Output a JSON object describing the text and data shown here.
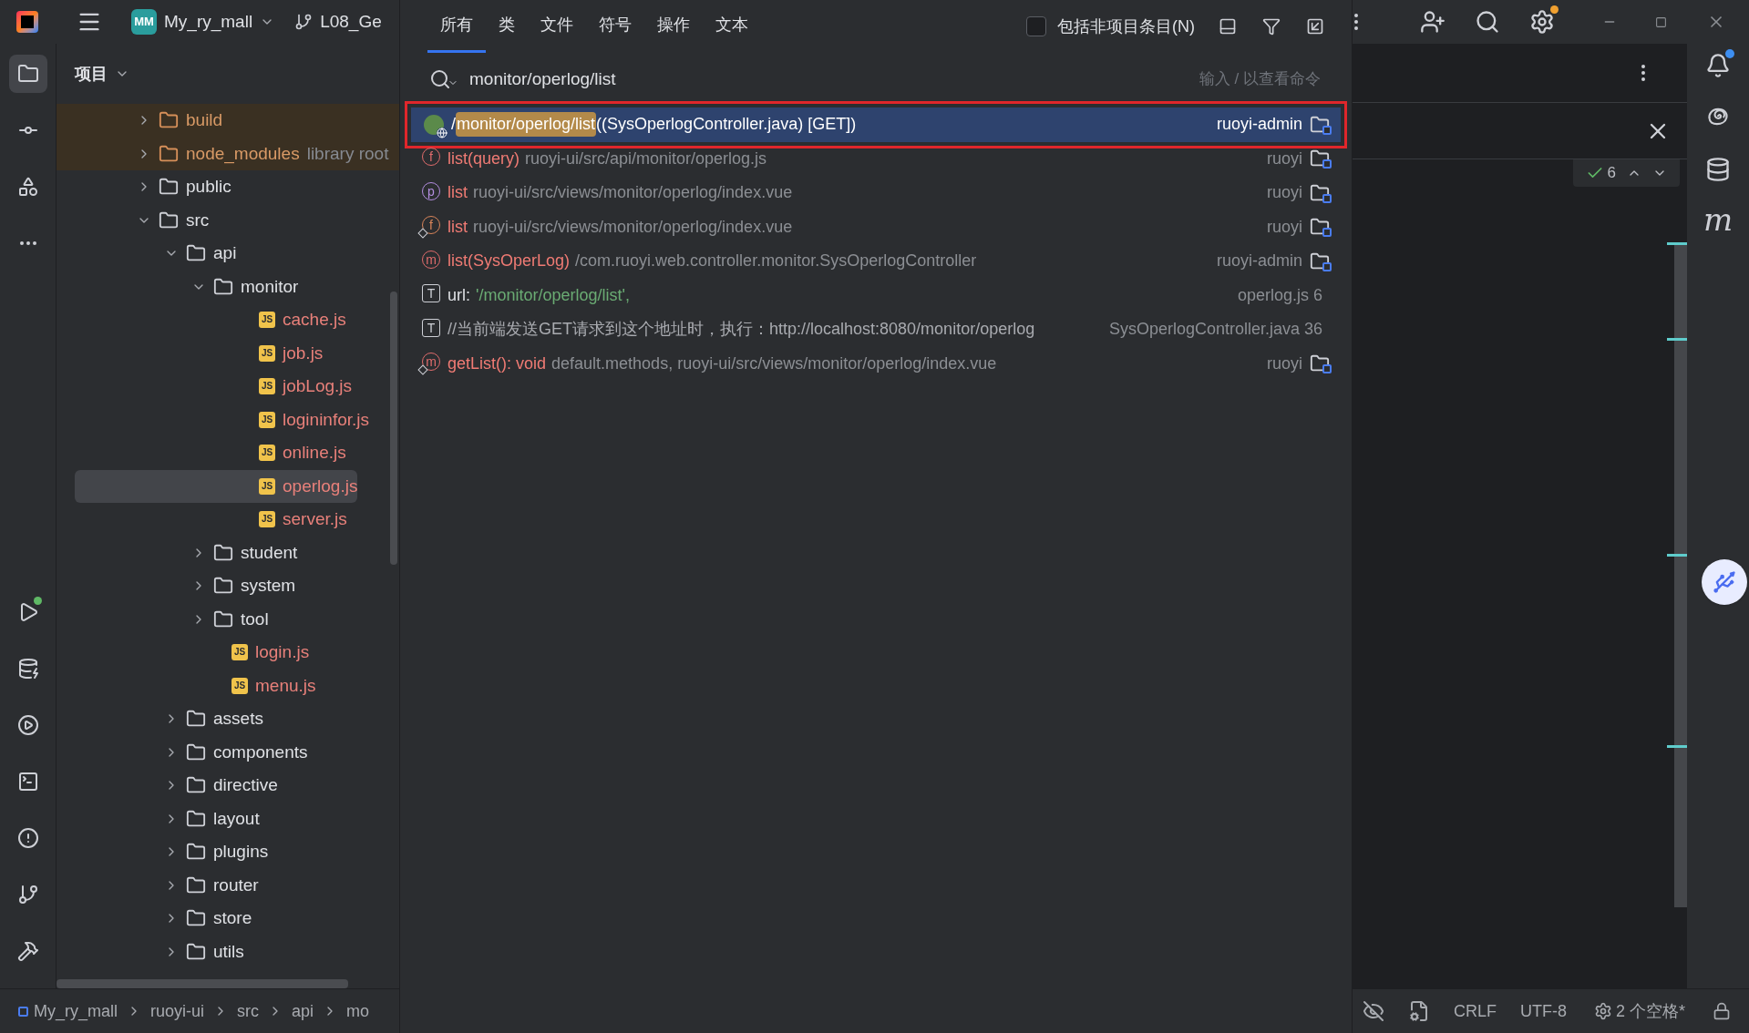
{
  "top_bar": {
    "project_badge": "MM",
    "project": "My_ry_mall",
    "branch": "L08_Ge"
  },
  "project_panel": {
    "title": "项目",
    "tree": [
      {
        "name": "build",
        "kind": "excluded",
        "expanded": false,
        "selected": false
      },
      {
        "name": "node_modules",
        "kind": "excluded",
        "hint": "library root",
        "expanded": false,
        "selected": false
      },
      {
        "name": "public",
        "kind": "folder",
        "expanded": false,
        "selected": false
      },
      {
        "name": "src",
        "kind": "folder",
        "expanded": true,
        "selected": false,
        "children": [
          {
            "name": "api",
            "kind": "folder",
            "expanded": true,
            "selected": false,
            "children": [
              {
                "name": "monitor",
                "kind": "folder",
                "expanded": true,
                "selected": false,
                "children": [
                  {
                    "name": "cache.js",
                    "kind": "js",
                    "badge": "JS",
                    "selected": false
                  },
                  {
                    "name": "job.js",
                    "kind": "js",
                    "badge": "JS",
                    "selected": false
                  },
                  {
                    "name": "jobLog.js",
                    "kind": "js",
                    "badge": "JS",
                    "selected": false
                  },
                  {
                    "name": "logininfor.js",
                    "kind": "js",
                    "badge": "JS",
                    "selected": false
                  },
                  {
                    "name": "online.js",
                    "kind": "js",
                    "badge": "JS",
                    "selected": false
                  },
                  {
                    "name": "operlog.js",
                    "kind": "js",
                    "badge": "JS",
                    "selected": true
                  },
                  {
                    "name": "server.js",
                    "kind": "js",
                    "badge": "JS",
                    "selected": false
                  }
                ]
              },
              {
                "name": "student",
                "kind": "folder",
                "expanded": false,
                "selected": false
              },
              {
                "name": "system",
                "kind": "folder",
                "expanded": false,
                "selected": false
              },
              {
                "name": "tool",
                "kind": "folder",
                "expanded": false,
                "selected": false
              },
              {
                "name": "login.js",
                "kind": "js",
                "badge": "JS",
                "selected": false
              },
              {
                "name": "menu.js",
                "kind": "js",
                "badge": "JS",
                "selected": false
              }
            ]
          },
          {
            "name": "assets",
            "kind": "folder",
            "expanded": false,
            "selected": false
          },
          {
            "name": "components",
            "kind": "folder",
            "expanded": false,
            "selected": false
          },
          {
            "name": "directive",
            "kind": "folder",
            "expanded": false,
            "selected": false
          },
          {
            "name": "layout",
            "kind": "folder",
            "expanded": false,
            "selected": false
          },
          {
            "name": "plugins",
            "kind": "folder",
            "expanded": false,
            "selected": false
          },
          {
            "name": "router",
            "kind": "folder",
            "expanded": false,
            "selected": false
          },
          {
            "name": "store",
            "kind": "folder",
            "expanded": false,
            "selected": false
          },
          {
            "name": "utils",
            "kind": "folder",
            "expanded": false,
            "selected": false
          }
        ]
      }
    ]
  },
  "search_popup": {
    "tabs": [
      {
        "label": "所有",
        "selected": true
      },
      {
        "label": "类",
        "selected": false
      },
      {
        "label": "文件",
        "selected": false
      },
      {
        "label": "符号",
        "selected": false
      },
      {
        "label": "操作",
        "selected": false
      },
      {
        "label": "文本",
        "selected": false
      }
    ],
    "include_non_project": {
      "label": "包括非项目条目(N)",
      "checked": false
    },
    "search": {
      "value": "monitor/operlog/list",
      "placeholder": "输入 / 以查看命令"
    },
    "results": [
      {
        "kind": "endpoint",
        "prefix": "/",
        "match": "monitor/operlog/list",
        "name": " ((SysOperlogController.java) [GET])",
        "location": "ruoyi-admin",
        "folder": true,
        "selected": true
      },
      {
        "kind": "symbol",
        "letter": "f",
        "color": "#e06c6c",
        "name": "list(query)",
        "detail": "ruoyi-ui/src/api/monitor/operlog.js",
        "location": "ruoyi",
        "folder": true,
        "overlay": false,
        "selected": false
      },
      {
        "kind": "symbol",
        "letter": "p",
        "color": "#b48ee0",
        "name": "list",
        "detail": "ruoyi-ui/src/views/monitor/operlog/index.vue",
        "location": "ruoyi",
        "folder": true,
        "overlay": false,
        "selected": false
      },
      {
        "kind": "symbol",
        "letter": "f",
        "color": "#d9855a",
        "name": "list",
        "detail": "ruoyi-ui/src/views/monitor/operlog/index.vue",
        "location": "ruoyi",
        "folder": true,
        "overlay": true,
        "selected": false
      },
      {
        "kind": "symbol",
        "letter": "m",
        "color": "#e06c6c",
        "name": "list(SysOperLog)",
        "detail": "/com.ruoyi.web.controller.monitor.SysOperlogController",
        "location": "ruoyi-admin",
        "folder": true,
        "overlay": false,
        "selected": false
      },
      {
        "kind": "text",
        "letter": "T",
        "name": "url: ",
        "detail": "'/monitor/operlog/list',",
        "location": "operlog.js 6",
        "folder": false,
        "overlay": false,
        "selected": false
      },
      {
        "kind": "text",
        "letter": "T",
        "name": "//当前端发送GET请求到这个地址时，执行：http://localhost:8080/monitor/operlog",
        "location": "SysOperlogController.java 36",
        "folder": false,
        "overlay": false,
        "selected": false
      },
      {
        "kind": "symbol",
        "letter": "m",
        "color": "#e06c6c",
        "name": "getList(): void",
        "detail": "default.methods, ruoyi-ui/src/views/monitor/operlog/index.vue",
        "location": "ruoyi",
        "folder": true,
        "overlay": true,
        "selected": false
      }
    ]
  },
  "editor": {
    "inspection_count": "6"
  },
  "right_tools": {
    "maven_glyph": "m"
  },
  "status_bar": {
    "breadcrumb": [
      "My_ry_mall",
      "ruoyi-ui",
      "src",
      "api",
      "mo"
    ],
    "line_separator": "CRLF",
    "encoding": "UTF-8",
    "indent": "2 个空格*"
  }
}
